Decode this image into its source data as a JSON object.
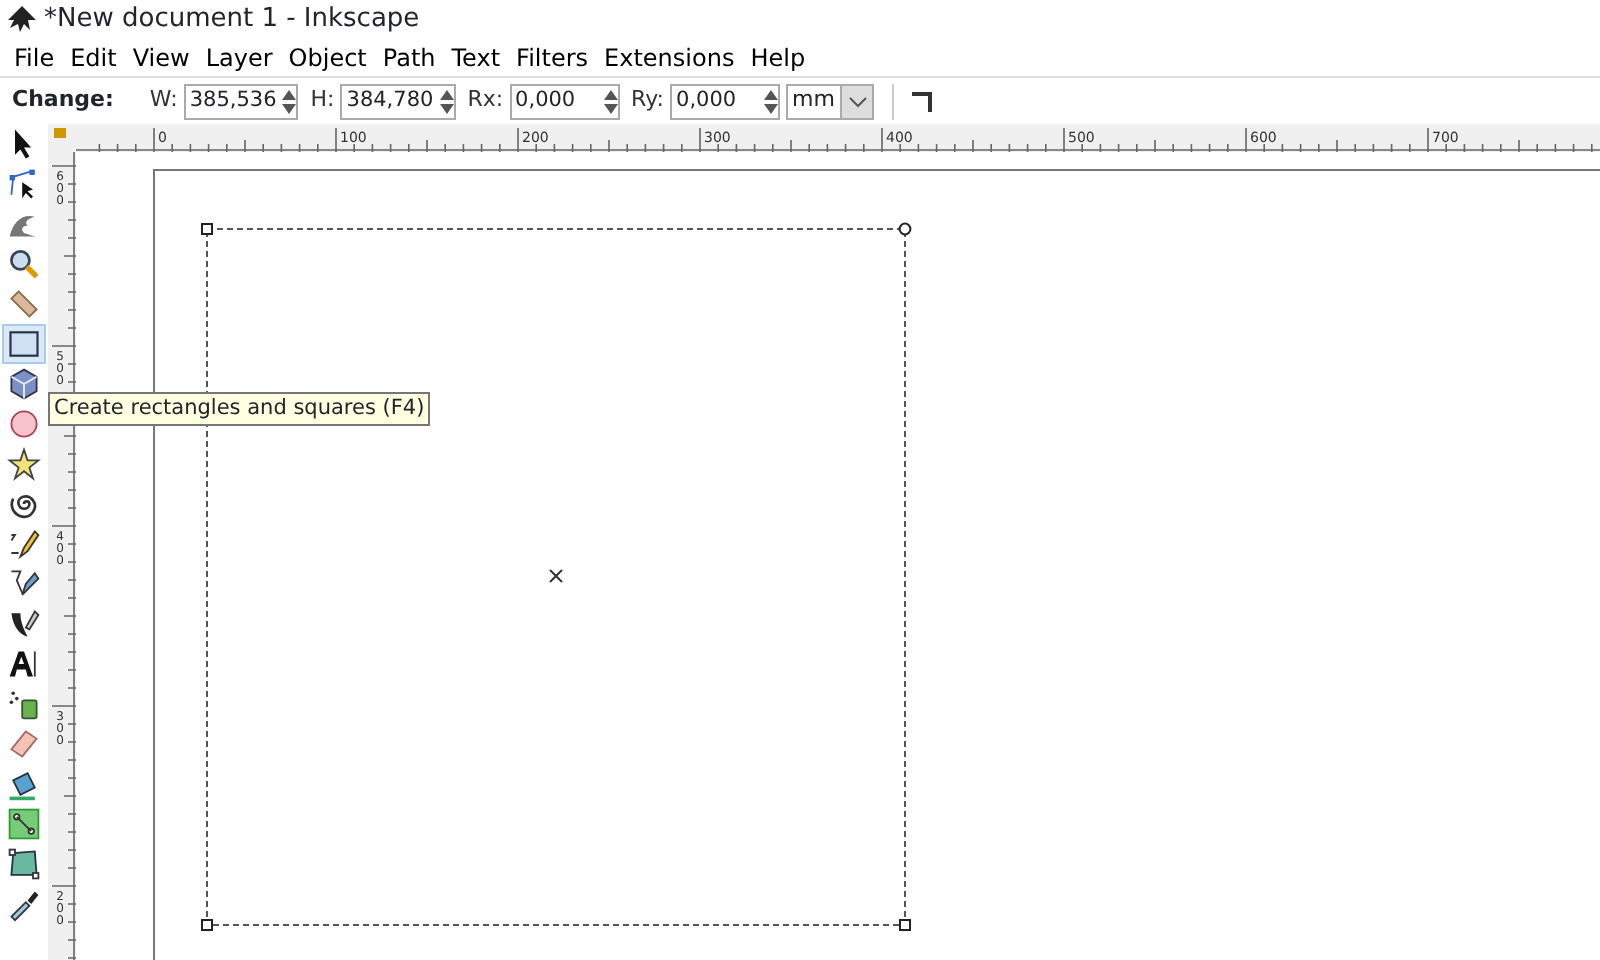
{
  "window": {
    "title": "*New document 1 - Inkscape"
  },
  "menu": [
    "File",
    "Edit",
    "View",
    "Layer",
    "Object",
    "Path",
    "Text",
    "Filters",
    "Extensions",
    "Help"
  ],
  "tool_controls": {
    "label": "Change:",
    "fields": [
      {
        "label": "W:",
        "value": "385,536",
        "kind": "spin"
      },
      {
        "label": "H:",
        "value": "384,780",
        "kind": "spin"
      },
      {
        "label": "Rx:",
        "value": "0,000",
        "kind": "spin"
      },
      {
        "label": "Ry:",
        "value": "0,000",
        "kind": "spin"
      }
    ],
    "unit": "mm"
  },
  "tools": [
    {
      "kind": "selector",
      "selected": false
    },
    {
      "kind": "node",
      "selected": false
    },
    {
      "kind": "tweak",
      "selected": false
    },
    {
      "kind": "zoom",
      "selected": false
    },
    {
      "kind": "measure",
      "selected": false
    },
    {
      "kind": "rect",
      "selected": true
    },
    {
      "kind": "box3d",
      "selected": false
    },
    {
      "kind": "ellipse",
      "selected": false
    },
    {
      "kind": "star",
      "selected": false
    },
    {
      "kind": "spiral",
      "selected": false
    },
    {
      "kind": "pencil",
      "selected": false
    },
    {
      "kind": "pen",
      "selected": false
    },
    {
      "kind": "calligraphy",
      "selected": false
    },
    {
      "kind": "text",
      "selected": false
    },
    {
      "kind": "spray",
      "selected": false
    },
    {
      "kind": "eraser",
      "selected": false
    },
    {
      "kind": "bucket",
      "selected": false
    },
    {
      "kind": "gradient",
      "selected": false
    },
    {
      "kind": "mesh",
      "selected": false
    },
    {
      "kind": "dropper",
      "selected": false
    }
  ],
  "horizontal_ruler": [
    "0",
    "100",
    "200",
    "300",
    "400",
    "500",
    "600",
    "700"
  ],
  "vertical_ruler": [
    "600",
    "500",
    "400",
    "300",
    "200"
  ],
  "tooltip": "Create rectangles and squares (F4)"
}
